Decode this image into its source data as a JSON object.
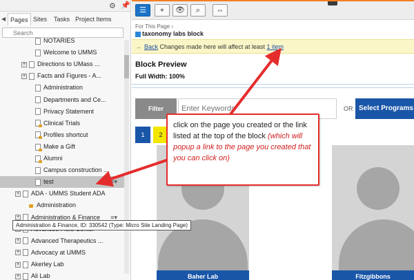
{
  "left_panel": {
    "tabs": [
      "Pages",
      "Sites",
      "Tasks",
      "Project Items"
    ],
    "active_tab": "Pages",
    "search_placeholder": "Search",
    "tree": [
      {
        "label": "NOTARIES",
        "kind": "page",
        "indent": 2,
        "expander": false
      },
      {
        "label": "Welcome to UMMS",
        "kind": "page",
        "indent": 2,
        "expander": false
      },
      {
        "label": "Directions to UMass ...",
        "kind": "page",
        "indent": 1,
        "expander": true
      },
      {
        "label": "Facts and Figures - A...",
        "kind": "page",
        "indent": 1,
        "expander": true
      },
      {
        "label": "Administration",
        "kind": "page",
        "indent": 2,
        "expander": false
      },
      {
        "label": "Departments and Ce...",
        "kind": "page",
        "indent": 2,
        "expander": false
      },
      {
        "label": "Privacy Statement",
        "kind": "page",
        "indent": 2,
        "expander": false
      },
      {
        "label": "Clinical Trials",
        "kind": "lock",
        "indent": 2,
        "expander": false
      },
      {
        "label": "Profiles shortcut",
        "kind": "lock",
        "indent": 2,
        "expander": false
      },
      {
        "label": "Make a Gift",
        "kind": "lock",
        "indent": 2,
        "expander": false
      },
      {
        "label": "Alumni",
        "kind": "lock",
        "indent": 2,
        "expander": false
      },
      {
        "label": "Campus construction ...",
        "kind": "page",
        "indent": 2,
        "expander": false
      },
      {
        "label": "test",
        "kind": "page",
        "indent": 2,
        "expander": false,
        "selected": true
      },
      {
        "label": "ADA - UMMS Student ADA",
        "kind": "page",
        "indent": 0,
        "expander": true
      },
      {
        "label": "Administration",
        "kind": "site",
        "indent": 1,
        "expander": false
      },
      {
        "label": "Administration & Finance",
        "kind": "page",
        "indent": 0,
        "expander": true
      },
      {
        "label": "Advanced Fluid Center",
        "kind": "page",
        "indent": 0,
        "expander": true
      },
      {
        "label": "Advanced Therapeutics ...",
        "kind": "page",
        "indent": 0,
        "expander": true
      },
      {
        "label": "Advocacy at UMMS",
        "kind": "page",
        "indent": 0,
        "expander": true
      },
      {
        "label": "Akerley Lab",
        "kind": "page",
        "indent": 0,
        "expander": true
      },
      {
        "label": "Ali Lab",
        "kind": "page",
        "indent": 0,
        "expander": true
      }
    ],
    "tooltip": "Administration & Finance, ID: 330542 (Type: Micro Site Landing Page)"
  },
  "editor": {
    "breadcrumb": "For This Page",
    "page_title": "taxonomy labs block",
    "notice": {
      "back": "Back",
      "message": "Changes made here will affect at least",
      "count_link": "1 item"
    },
    "preview_title": "Block Preview",
    "preview_width": "Full Width: 100%",
    "filter_label": "Filter",
    "keyword_placeholder": "Enter Keywords",
    "or_label": "OR",
    "select_programs": "Select Programs",
    "pages": [
      "1",
      "2"
    ],
    "cards": [
      "Baher Lab",
      "Fitzgibbons"
    ]
  },
  "callout": {
    "main": "click on the page you created or the link listed at the top of the block",
    "note": "(which will popup a link to the page you created that you can click on)"
  },
  "colors": {
    "accent_blue": "#1a56a8",
    "callout_red": "#e52c2c",
    "notice_yellow": "#fbf6c8",
    "orange": "#f57e20"
  }
}
